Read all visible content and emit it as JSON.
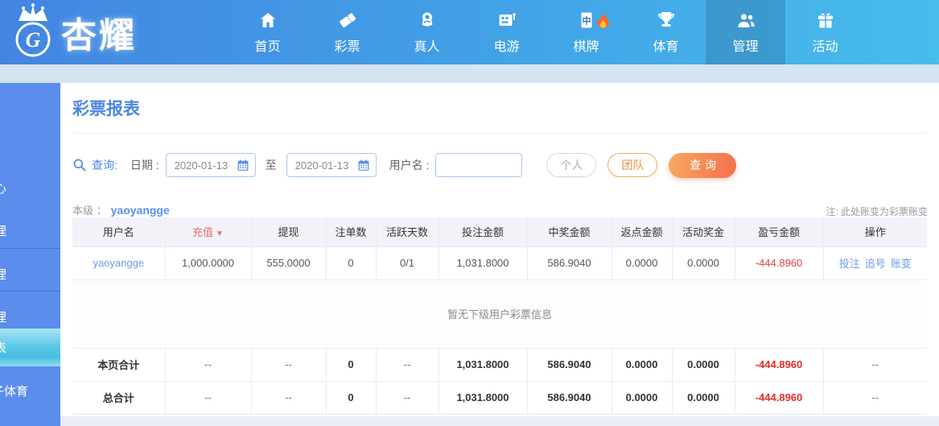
{
  "nav": {
    "logo_text": "杏耀",
    "items": [
      {
        "label": "首页",
        "icon": "home-icon",
        "active": false
      },
      {
        "label": "彩票",
        "icon": "ticket-icon",
        "active": false
      },
      {
        "label": "真人",
        "icon": "person-icon",
        "active": false
      },
      {
        "label": "电游",
        "icon": "slot-machine-icon",
        "active": false
      },
      {
        "label": "棋牌",
        "icon": "mahjong-tile-icon",
        "badge": "fire",
        "active": false
      },
      {
        "label": "体育",
        "icon": "trophy-icon",
        "active": false
      },
      {
        "label": "管理",
        "icon": "users-icon",
        "active": true
      },
      {
        "label": "活动",
        "icon": "gift-icon",
        "active": false
      }
    ]
  },
  "sidebar": {
    "items": [
      {
        "label": "心",
        "active": false
      },
      {
        "label": "理",
        "active": false
      },
      {
        "label": "理",
        "active": false
      },
      {
        "label": "理",
        "active": false
      },
      {
        "label": "表",
        "active": true
      },
      {
        "label": "子体育",
        "active": false
      }
    ]
  },
  "main": {
    "title": "彩票报表",
    "query": {
      "search_label": "查询:",
      "date_label": "日期 :",
      "date_from": "2020-01-13",
      "to_label": "至",
      "date_to": "2020-01-13",
      "username_label": "用户名 :",
      "username_value": "",
      "personal_button": "个人",
      "team_button": "团队",
      "search_button": "查询"
    },
    "level_label": "本级 ：",
    "level_value": "yaoyangge",
    "note": "注: 此处账变为彩票账变",
    "table": {
      "headers": [
        "用户名",
        "充值",
        "提现",
        "注单数",
        "活跃天数",
        "投注金额",
        "中奖金额",
        "返点金额",
        "活动奖金",
        "盈亏金额",
        "操作"
      ],
      "sort_icon": "▼",
      "user_row": {
        "username": "yaoyangge",
        "recharge": "1,000.0000",
        "withdraw": "555.0000",
        "bet_count": "0",
        "active_days": "0/1",
        "bet_amount": "1,031.8000",
        "win_amount": "586.9040",
        "rebate_amount": "0.0000",
        "activity_bonus": "0.0000",
        "profit_loss": "-444.8960",
        "actions": [
          "投注",
          "追号",
          "账变"
        ]
      },
      "empty_text": "暂无下级用户彩票信息",
      "page_total": {
        "label": "本页合计",
        "recharge": "--",
        "withdraw": "--",
        "bet_count": "0",
        "active_days": "--",
        "bet_amount": "1,031.8000",
        "win_amount": "586.9040",
        "rebate_amount": "0.0000",
        "activity_bonus": "0.0000",
        "profit_loss": "-444.8960",
        "actions": "--"
      },
      "grand_total": {
        "label": "总合计",
        "recharge": "--",
        "withdraw": "--",
        "bet_count": "0",
        "active_days": "--",
        "bet_amount": "1,031.8000",
        "win_amount": "586.9040",
        "rebate_amount": "0.0000",
        "activity_bonus": "0.0000",
        "profit_loss": "-444.8960",
        "actions": "--"
      }
    }
  },
  "colors": {
    "nav_gradient_left": "#4285e1",
    "nav_gradient_right": "#47bdec",
    "sidebar_blue": "#5b8ded",
    "sidebar_active_cyan": "#5ec8e6",
    "accent_blue": "#4a87e0",
    "link_blue": "#6d9bec",
    "negative_red": "#e53e3e",
    "sort_red": "#f56b6b",
    "button_orange_start": "#f8a85e",
    "button_orange_end": "#f2714d"
  }
}
